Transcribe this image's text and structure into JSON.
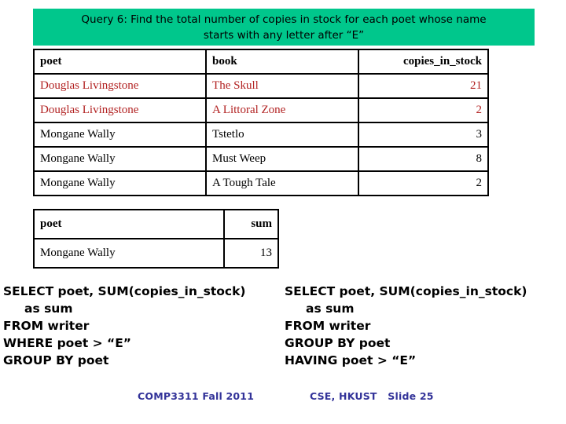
{
  "banner": {
    "text": "Query 6: Find the total number of copies in stock for each poet whose name\nstarts with any letter after “E”",
    "background_color": "#00C78C",
    "text_color": "#000000"
  },
  "result_table": {
    "headers": [
      "poet",
      "book",
      "copies_in_stock"
    ],
    "rows": [
      {
        "poet": "Douglas Livingstone",
        "book": "The Skull",
        "copies_in_stock": "21",
        "color": "#B22222"
      },
      {
        "poet": "Douglas Livingstone",
        "book": "A Littoral Zone",
        "copies_in_stock": "2",
        "color": "#B22222"
      },
      {
        "poet": "Mongane Wally",
        "book": "Tstetlo",
        "copies_in_stock": "3",
        "color": "#000000"
      },
      {
        "poet": "Mongane Wally",
        "book": "Must Weep",
        "copies_in_stock": "8",
        "color": "#000000"
      },
      {
        "poet": "Mongane Wally",
        "book": "A Tough Tale",
        "copies_in_stock": "2",
        "color": "#000000"
      }
    ]
  },
  "summary_table": {
    "headers": [
      "poet",
      "sum"
    ],
    "rows": [
      {
        "poet": "Mongane Wally",
        "sum": "13"
      }
    ]
  },
  "sql_left": {
    "text": "SELECT poet, SUM(copies_in_stock)\n     as sum\nFROM writer\nWHERE poet > “E”\nGROUP BY poet"
  },
  "sql_right": {
    "text": "SELECT poet, SUM(copies_in_stock)\n     as sum\nFROM writer\nGROUP BY poet\nHAVING poet > “E”"
  },
  "footer": {
    "course": "COMP3311 Fall 2011",
    "credit": "CSE, HKUST   Slide 25",
    "color": "#333399"
  }
}
